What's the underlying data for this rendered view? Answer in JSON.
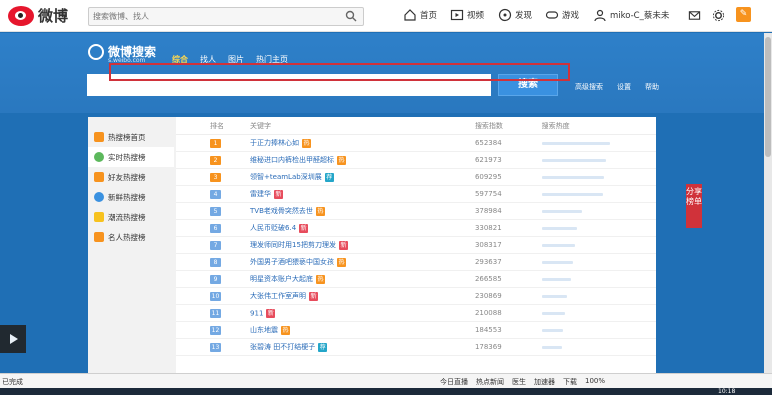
{
  "topbar": {
    "logo_text": "微博",
    "search_placeholder": "搜索微博、找人",
    "nav": [
      {
        "label": "首页",
        "icon": "home-icon"
      },
      {
        "label": "视频",
        "icon": "video-icon"
      },
      {
        "label": "发现",
        "icon": "discover-icon"
      },
      {
        "label": "游戏",
        "icon": "game-icon"
      },
      {
        "label": "miko-C_蔡未未",
        "icon": "user-icon"
      }
    ]
  },
  "weibo_search": {
    "title": "微博搜索",
    "url": "s.weibo.com",
    "tabs": [
      "综合",
      "找人",
      "图片",
      "热门主页"
    ],
    "active_tab": "综合",
    "button": "搜索",
    "links": [
      "高级搜索",
      "设置",
      "帮助"
    ]
  },
  "leftnav": [
    {
      "label": "热搜榜首页",
      "icon": "home-icon",
      "color": "#f7931e"
    },
    {
      "label": "实时热搜榜",
      "icon": "clock-icon",
      "color": "#5cb85c"
    },
    {
      "label": "好友热搜榜",
      "icon": "friends-icon",
      "color": "#f7931e"
    },
    {
      "label": "新鲜热搜榜",
      "icon": "search-icon",
      "color": "#3a91e0"
    },
    {
      "label": "潮流热搜榜",
      "icon": "star-icon",
      "color": "#f7c21e"
    },
    {
      "label": "名人热搜榜",
      "icon": "person-icon",
      "color": "#f7931e"
    }
  ],
  "rank_table": {
    "headers": [
      "排名",
      "关键字",
      "搜索指数",
      "搜索热度"
    ],
    "rows": [
      {
        "rank": "1",
        "keyword": "于正力捧林心如",
        "count": "652384",
        "tag": "热",
        "tag_type": "hot",
        "heat": 0.62
      },
      {
        "rank": "2",
        "keyword": "维秘进口内裤检出甲醛超标",
        "count": "621973",
        "tag": "热",
        "tag_type": "hot",
        "heat": 0.58
      },
      {
        "rank": "3",
        "keyword": "领智+teamLab深圳展",
        "count": "609295",
        "tag": "荐",
        "tag_type": "rec",
        "heat": 0.56
      },
      {
        "rank": "4",
        "keyword": "雷建华",
        "count": "597754",
        "tag": "新",
        "tag_type": "new",
        "heat": 0.55
      },
      {
        "rank": "5",
        "keyword": "TVB老戏骨突然去世",
        "count": "378984",
        "tag": "热",
        "tag_type": "hot",
        "heat": 0.36
      },
      {
        "rank": "6",
        "keyword": "人民币贬破6.4",
        "count": "330821",
        "tag": "新",
        "tag_type": "new",
        "heat": 0.32
      },
      {
        "rank": "7",
        "keyword": "理发师同时用15把剪刀理发",
        "count": "308317",
        "tag": "新",
        "tag_type": "new",
        "heat": 0.3
      },
      {
        "rank": "8",
        "keyword": "外国男子酒吧猥亵中国女孩",
        "count": "293637",
        "tag": "热",
        "tag_type": "hot",
        "heat": 0.28
      },
      {
        "rank": "9",
        "keyword": "明星资本账户大起底",
        "count": "266585",
        "tag": "热",
        "tag_type": "hot",
        "heat": 0.26
      },
      {
        "rank": "10",
        "keyword": "大张伟工作室声明",
        "count": "230869",
        "tag": "新",
        "tag_type": "new",
        "heat": 0.23
      },
      {
        "rank": "11",
        "keyword": "911",
        "count": "210088",
        "tag": "新",
        "tag_type": "new",
        "heat": 0.21
      },
      {
        "rank": "12",
        "keyword": "山东地震",
        "count": "184553",
        "tag": "热",
        "tag_type": "hot",
        "heat": 0.19
      },
      {
        "rank": "13",
        "keyword": "张碧涛 田不打结梗子",
        "count": "178369",
        "tag": "荐",
        "tag_type": "rec",
        "heat": 0.18
      }
    ]
  },
  "share_label": "分享榜单",
  "statusbar": {
    "left": "已完成",
    "items": [
      "今日直播",
      "热点新闻",
      "医生",
      "加速器",
      "下载",
      "100%"
    ]
  },
  "clock": "10:18"
}
